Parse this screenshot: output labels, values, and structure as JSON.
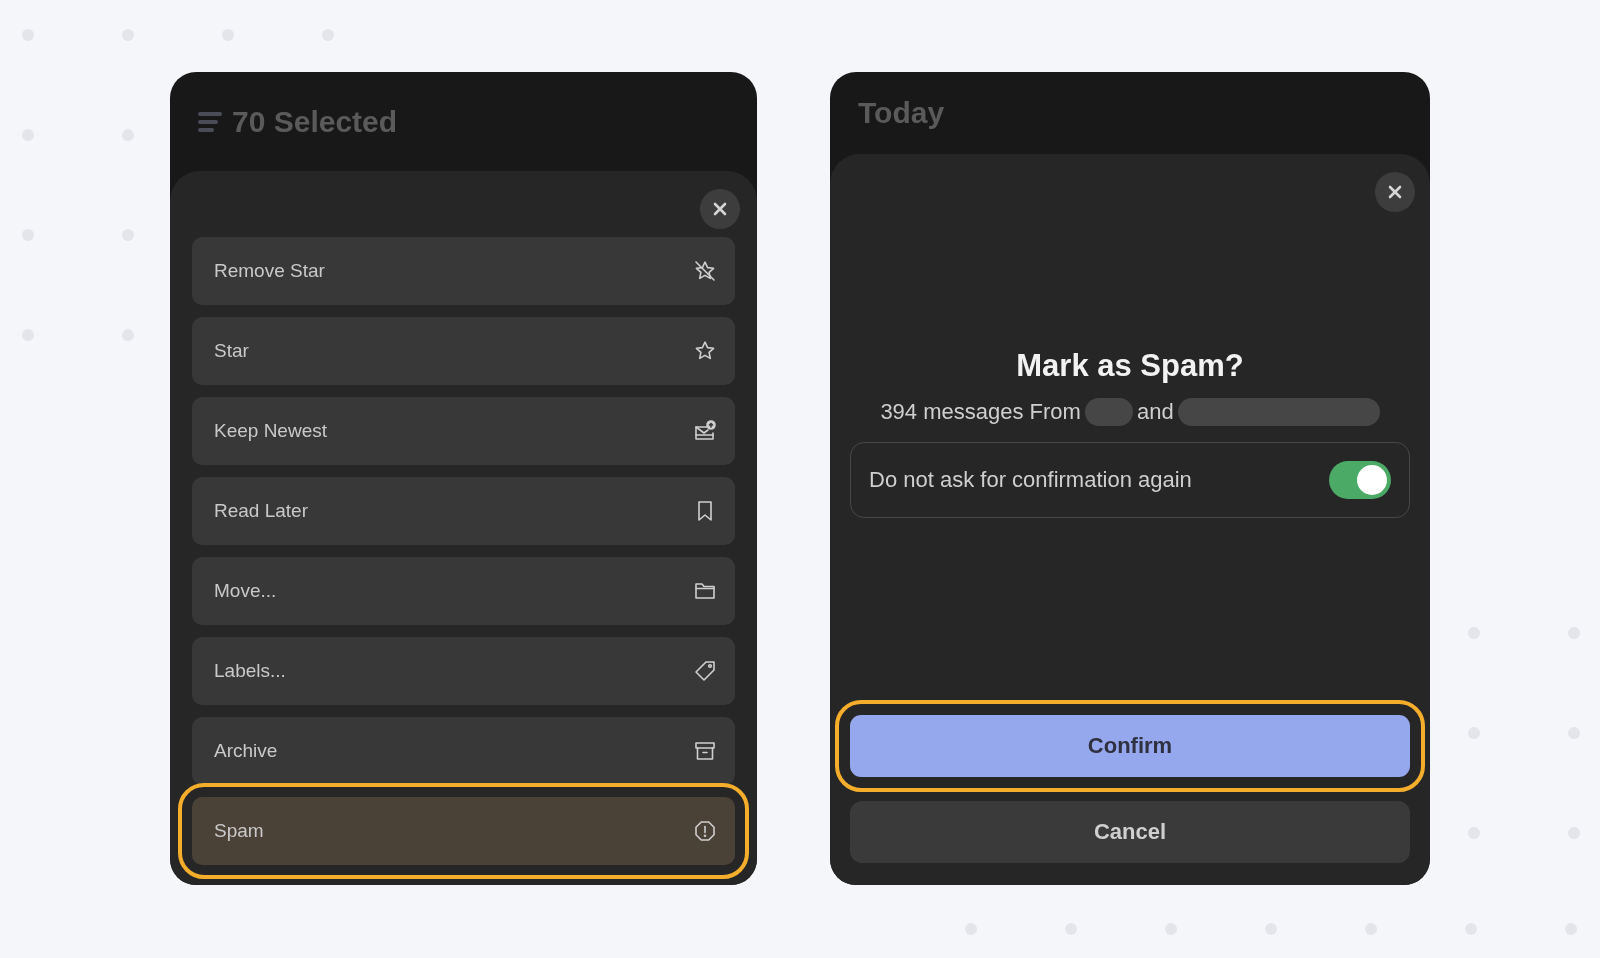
{
  "menu_panel": {
    "header_title": "70 Selected",
    "actions": [
      {
        "label": "Remove Star",
        "kind": "unstar",
        "highlighted": false
      },
      {
        "label": "Star",
        "kind": "star",
        "highlighted": false
      },
      {
        "label": "Keep Newest",
        "kind": "keep",
        "highlighted": false
      },
      {
        "label": "Read Later",
        "kind": "later",
        "highlighted": false
      },
      {
        "label": "Move...",
        "kind": "move",
        "highlighted": false
      },
      {
        "label": "Labels...",
        "kind": "labels",
        "highlighted": false
      },
      {
        "label": "Archive",
        "kind": "archive",
        "highlighted": false
      },
      {
        "label": "Spam",
        "kind": "spam",
        "highlighted": true
      }
    ]
  },
  "dialog_panel": {
    "header_title": "Today",
    "title": "Mark as Spam?",
    "subtitle_parts": [
      "394 messages From",
      "and"
    ],
    "toggle": {
      "label": "Do not ask for confirmation again",
      "on": true
    },
    "buttons": [
      {
        "label": "Confirm",
        "kind": "primary",
        "highlighted": true
      },
      {
        "label": "Cancel",
        "kind": "secondary",
        "highlighted": false
      }
    ]
  }
}
